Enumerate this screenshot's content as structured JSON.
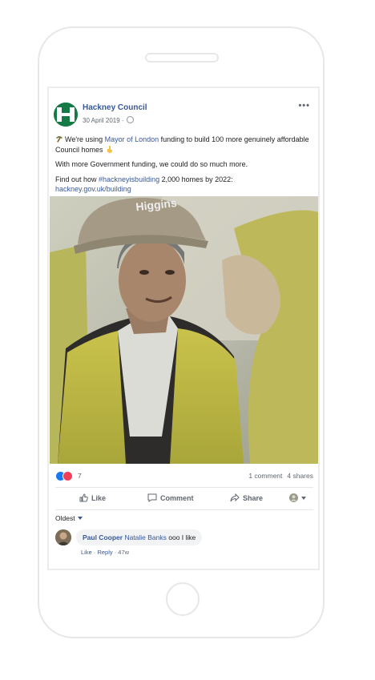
{
  "post": {
    "page_name": "Hackney Council",
    "date": "30 April 2019 ·",
    "more_label": "•••",
    "line1_before": "We're using ",
    "line1_link": "Mayor of London",
    "line1_after": " funding to build 100 more genuinely affordable Council homes",
    "line2": "With more Government funding, we could do so much more.",
    "line3_before": "Find out how ",
    "line3_hashtag": "#hackneyisbuilding",
    "line3_after": " 2,000 homes by 2022:",
    "url": "hackney.gov.uk/building",
    "image_helmet_text": "Higgins"
  },
  "counts": {
    "reactions": "7",
    "comments": "1 comment",
    "shares": "4 shares"
  },
  "actions": {
    "like": "Like",
    "comment": "Comment",
    "share": "Share"
  },
  "sort": {
    "label": "Oldest"
  },
  "comment": {
    "author": "Paul Cooper",
    "tag": "Natalie Banks",
    "text": " ooo I like",
    "like": "Like",
    "reply": "Reply",
    "time": "47w",
    "sep": " · "
  },
  "colors": {
    "link": "#385898",
    "like_blue": "#1877f2",
    "love_red": "#f33e58",
    "brand_green": "#157a45"
  }
}
